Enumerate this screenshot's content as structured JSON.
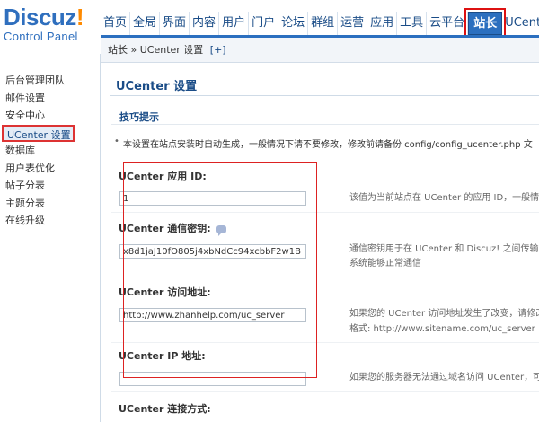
{
  "logo": {
    "main": "Discuz",
    "mark": "!",
    "sub": "Control Panel"
  },
  "topnav": {
    "items": [
      {
        "label": "首页"
      },
      {
        "label": "全局"
      },
      {
        "label": "界面"
      },
      {
        "label": "内容"
      },
      {
        "label": "用户"
      },
      {
        "label": "门户"
      },
      {
        "label": "论坛"
      },
      {
        "label": "群组"
      },
      {
        "label": "运营"
      },
      {
        "label": "应用"
      },
      {
        "label": "工具"
      },
      {
        "label": "云平台"
      },
      {
        "label": "站长",
        "active": true
      },
      {
        "label": "UCenter"
      }
    ]
  },
  "sidebar": {
    "items": [
      {
        "label": "后台管理团队"
      },
      {
        "label": "邮件设置"
      },
      {
        "label": "安全中心"
      },
      {
        "label": "UCenter 设置",
        "active": true
      },
      {
        "label": "数据库"
      },
      {
        "label": "用户表优化"
      },
      {
        "label": "帖子分表"
      },
      {
        "label": "主题分表"
      },
      {
        "label": "在线升级"
      }
    ]
  },
  "breadcrumb": {
    "text": "站长 » UCenter 设置",
    "add": "[+]"
  },
  "page": {
    "title": "UCenter 设置",
    "tips_head": "技巧提示",
    "tips_text": "本设置在站点安装时自动生成，一般情况下请不要修改，修改前请备份 config/config_ucenter.php 文"
  },
  "fields": {
    "app_id": {
      "label": "UCenter 应用 ID:",
      "value": "1",
      "desc": "该值为当前站点在 UCenter 的应用 ID，一般情"
    },
    "key": {
      "label": "UCenter 通信密钥:",
      "value": "x8d1jaJ10fO805j4xbNdCc94xcbbF2w1B",
      "desc1": "通信密钥用于在 UCenter 和 Discuz! 之间传输",
      "desc2": "系统能够正常通信"
    },
    "url": {
      "label": "UCenter 访问地址:",
      "value": "http://www.zhanhelp.com/uc_server",
      "desc1": "如果您的 UCenter 访问地址发生了改变，请修改",
      "desc2": "格式: http://www.sitename.com/uc_server"
    },
    "ip": {
      "label": "UCenter IP 地址:",
      "value": "",
      "desc": "如果您的服务器无法通过域名访问 UCenter，可"
    },
    "connect": {
      "label": "UCenter 连接方式:"
    }
  },
  "colors": {
    "accent": "#2b6fbf",
    "logo_orange": "#ff8a00",
    "highlight": "#d22"
  },
  "icons": {
    "help": "speech-bubble-help-icon"
  }
}
